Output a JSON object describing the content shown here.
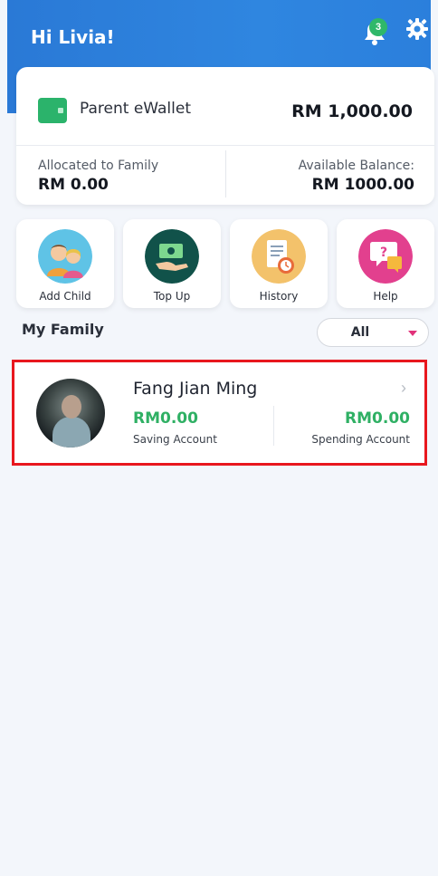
{
  "header": {
    "greeting": "Hi Livia!",
    "notification_count": "3",
    "icons": [
      "bell-icon",
      "gear-icon"
    ]
  },
  "wallet": {
    "name": "Parent eWallet",
    "balance": "RM 1,000.00",
    "allocated_label": "Allocated to Family",
    "allocated_value": "RM 0.00",
    "available_label": "Available Balance:",
    "available_value": "RM 1000.00"
  },
  "actions": [
    {
      "label": "Add Child",
      "icon": "add-child-icon",
      "color": "#5fc3e6"
    },
    {
      "label": "Top Up",
      "icon": "top-up-icon",
      "color": "#11524a"
    },
    {
      "label": "History",
      "icon": "history-icon",
      "color": "#f3c26b"
    },
    {
      "label": "Help",
      "icon": "help-icon",
      "color": "#e2408e"
    }
  ],
  "family": {
    "title": "My Family",
    "filter_value": "All",
    "members": [
      {
        "name": "Fang Jian Ming",
        "saving_amount": "RM0.00",
        "saving_label": "Saving Account",
        "spending_amount": "RM0.00",
        "spending_label": "Spending Account"
      }
    ]
  },
  "colors": {
    "header": "#2a79d6",
    "accent_green": "#2fb064",
    "highlight_border": "#e8171e",
    "background": "#f3f6fb"
  }
}
